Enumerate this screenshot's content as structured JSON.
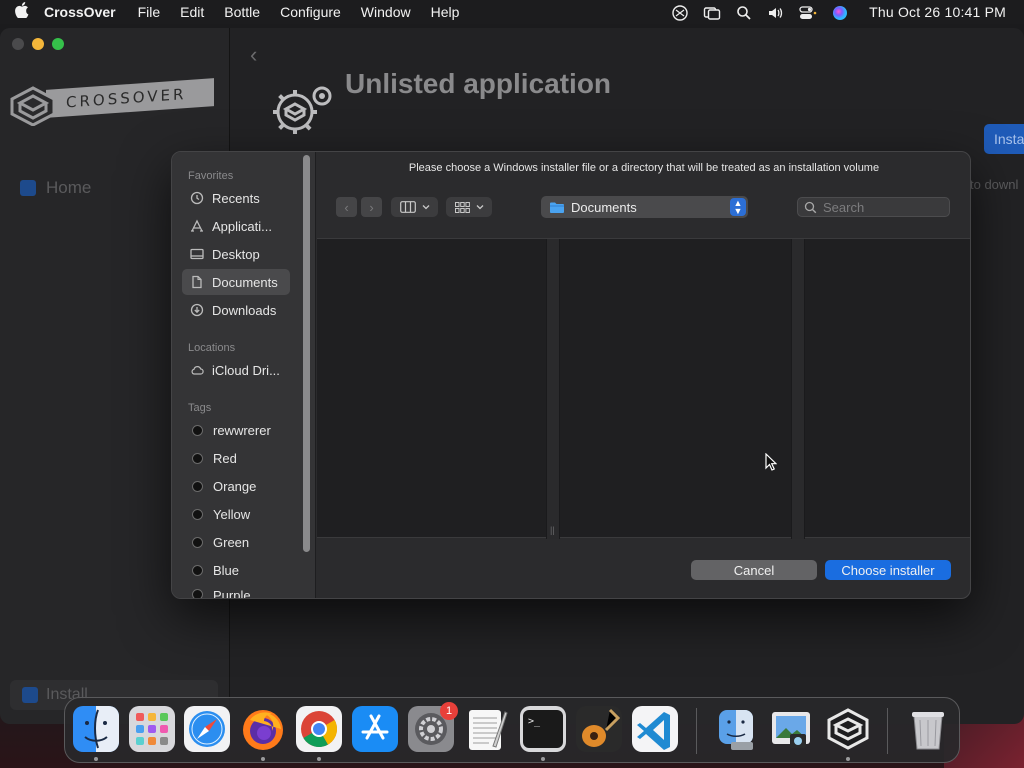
{
  "menubar": {
    "app_name": "CrossOver",
    "menus": [
      "File",
      "Edit",
      "Bottle",
      "Configure",
      "Window",
      "Help"
    ],
    "clock": "Thu Oct 26  10:41 PM"
  },
  "main_window": {
    "logo_text": "CROSSOVER",
    "sidebar_home": "Home",
    "sidebar_install": "Install",
    "title": "Unlisted application",
    "install_button": "Insta",
    "download_hint": "to downl"
  },
  "dialog": {
    "message": "Please choose a Windows installer file or a directory that will be treated as an installation volume",
    "favorites_header": "Favorites",
    "favorites": [
      {
        "label": "Recents",
        "icon": "clock-icon"
      },
      {
        "label": "Applicati...",
        "icon": "applications-icon"
      },
      {
        "label": "Desktop",
        "icon": "desktop-icon"
      },
      {
        "label": "Documents",
        "icon": "document-icon",
        "selected": true
      },
      {
        "label": "Downloads",
        "icon": "download-icon"
      }
    ],
    "locations_header": "Locations",
    "locations": [
      {
        "label": "iCloud Dri...",
        "icon": "cloud-icon"
      }
    ],
    "tags_header": "Tags",
    "tags": [
      "rewwrerer",
      "Red",
      "Orange",
      "Yellow",
      "Green",
      "Blue",
      "Purple"
    ],
    "location_popup": "Documents",
    "search_placeholder": "Search",
    "cancel_label": "Cancel",
    "choose_label": "Choose installer"
  },
  "dock": {
    "apps": [
      "Finder",
      "Launchpad",
      "Safari",
      "Firefox",
      "Chrome",
      "App Store",
      "System Settings",
      "TextEdit",
      "Terminal",
      "GarageBand",
      "Visual Studio Code",
      "Migration Assistant",
      "Preview",
      "CrossOver",
      "Trash"
    ],
    "settings_badge": "1"
  },
  "colors": {
    "accent": "#1a6de0",
    "dialog_bg": "#2b2b2d",
    "sidebar_bg": "#343436"
  }
}
